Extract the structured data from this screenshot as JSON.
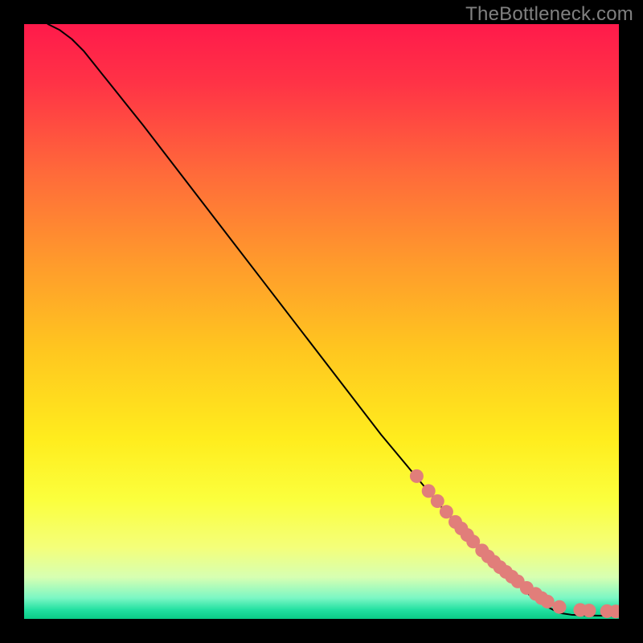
{
  "watermark": "TheBottleneck.com",
  "chart_data": {
    "type": "line",
    "title": "",
    "xlabel": "",
    "ylabel": "",
    "xlim": [
      0,
      100
    ],
    "ylim": [
      0,
      100
    ],
    "grid": false,
    "series": [
      {
        "name": "curve",
        "style": "line",
        "color": "#000000",
        "x": [
          4,
          6,
          8,
          10,
          12,
          14,
          16,
          20,
          25,
          30,
          35,
          40,
          45,
          50,
          55,
          60,
          65,
          70,
          75,
          80,
          85,
          88,
          90,
          92,
          94,
          96,
          98,
          100
        ],
        "y": [
          100,
          99,
          97.5,
          95.5,
          93,
          90.5,
          88,
          83,
          76.5,
          70,
          63.5,
          57,
          50.5,
          44,
          37.5,
          31,
          25,
          19,
          13.5,
          8.5,
          4.0,
          2.0,
          1.0,
          0.7,
          0.6,
          0.55,
          0.52,
          0.5
        ]
      },
      {
        "name": "dots-on-curve",
        "style": "points",
        "color": "#e17e7a",
        "x": [
          66,
          68,
          69.5,
          71,
          72.5,
          73.5,
          74.5,
          75.5,
          77,
          78,
          79,
          80,
          81,
          82,
          83,
          84.5,
          86,
          87,
          88,
          90,
          93.5,
          95,
          98,
          99.5
        ],
        "y": [
          24.0,
          21.5,
          19.8,
          18.0,
          16.3,
          15.2,
          14.1,
          13.0,
          11.5,
          10.5,
          9.6,
          8.7,
          7.9,
          7.1,
          6.3,
          5.2,
          4.2,
          3.5,
          2.9,
          2.0,
          1.5,
          1.4,
          1.3,
          1.25
        ]
      }
    ],
    "background_gradient": {
      "type": "vertical",
      "stops": [
        {
          "pos": 0.0,
          "color": "#ff1a4b"
        },
        {
          "pos": 0.1,
          "color": "#ff3346"
        },
        {
          "pos": 0.25,
          "color": "#ff6a3a"
        },
        {
          "pos": 0.4,
          "color": "#ff9a2c"
        },
        {
          "pos": 0.55,
          "color": "#ffc71f"
        },
        {
          "pos": 0.7,
          "color": "#ffed1e"
        },
        {
          "pos": 0.8,
          "color": "#fbff3d"
        },
        {
          "pos": 0.88,
          "color": "#f4ff7a"
        },
        {
          "pos": 0.93,
          "color": "#d7ffb2"
        },
        {
          "pos": 0.965,
          "color": "#7bf7c4"
        },
        {
          "pos": 0.985,
          "color": "#22e0a0"
        },
        {
          "pos": 1.0,
          "color": "#0acb86"
        }
      ]
    }
  }
}
